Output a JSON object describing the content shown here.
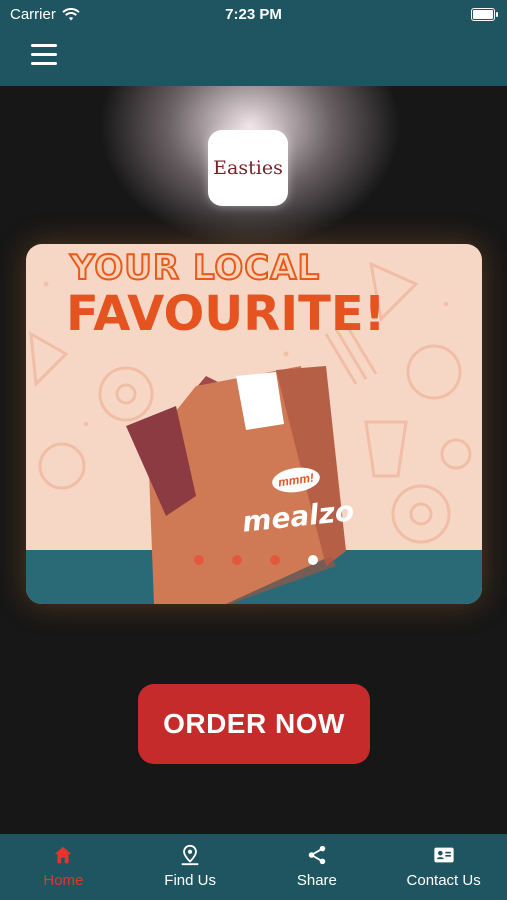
{
  "status_bar": {
    "carrier": "Carrier",
    "time": "7:23 PM",
    "wifi_icon": "wifi-icon",
    "battery_icon": "battery-icon"
  },
  "navbar": {
    "menu_icon": "hamburger-menu-icon"
  },
  "logo": {
    "text": "Easties"
  },
  "banner": {
    "headline_line1": "YOUR LOCAL",
    "headline_line2": "FAVOURITE!",
    "bag_brand": "mealzo",
    "speech_text": "mmm!",
    "slides_count": 4,
    "active_slide": 4
  },
  "order_button": {
    "label": "ORDER NOW"
  },
  "tab_bar": {
    "items": [
      {
        "label": "Home",
        "icon": "home-icon",
        "active": true
      },
      {
        "label": "Find Us",
        "icon": "location-pin-icon",
        "active": false
      },
      {
        "label": "Share",
        "icon": "share-icon",
        "active": false
      },
      {
        "label": "Contact Us",
        "icon": "contact-card-icon",
        "active": false
      }
    ]
  },
  "colors": {
    "bar": "#1f5560",
    "accent_red": "#c62b2b",
    "active_tab": "#e0362c",
    "headline_orange": "#e55420"
  }
}
